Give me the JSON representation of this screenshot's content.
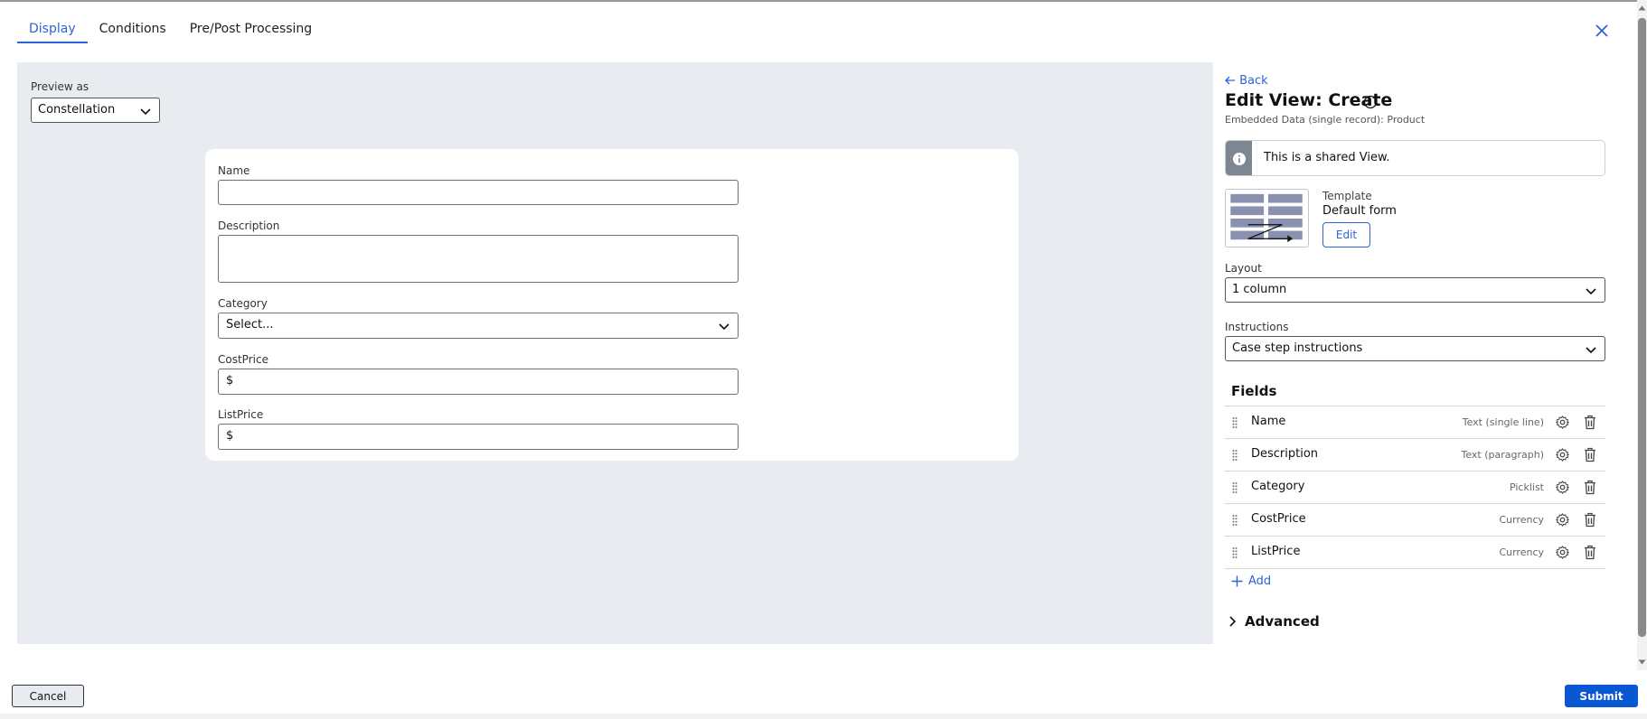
{
  "tabs": [
    {
      "label": "Display",
      "active": true
    },
    {
      "label": "Conditions",
      "active": false
    },
    {
      "label": "Pre/Post Processing",
      "active": false
    }
  ],
  "preview": {
    "label": "Preview as",
    "selected": "Constellation"
  },
  "form": {
    "name_label": "Name",
    "description_label": "Description",
    "category_label": "Category",
    "category_value": "Select...",
    "costprice_label": "CostPrice",
    "costprice_prefix": "$",
    "listprice_label": "ListPrice",
    "listprice_prefix": "$"
  },
  "panel": {
    "back": "Back",
    "title": "Edit View: Create",
    "subtitle": "Embedded Data (single record): Product",
    "shared_message": "This is a shared View.",
    "template_label": "Template",
    "template_value": "Default form",
    "template_edit": "Edit",
    "layout_label": "Layout",
    "layout_value": "1 column",
    "instructions_label": "Instructions",
    "instructions_value": "Case step instructions",
    "fields_heading": "Fields",
    "fields": [
      {
        "name": "Name",
        "type": "Text (single line)"
      },
      {
        "name": "Description",
        "type": "Text (paragraph)"
      },
      {
        "name": "Category",
        "type": "Picklist"
      },
      {
        "name": "CostPrice",
        "type": "Currency"
      },
      {
        "name": "ListPrice",
        "type": "Currency"
      }
    ],
    "add_label": "Add",
    "advanced_label": "Advanced"
  },
  "footer": {
    "cancel": "Cancel",
    "submit": "Submit"
  },
  "colors": {
    "accent": "#2b63d9",
    "submit_bg": "#0a57d4",
    "canvas_bg": "#e8ecf0",
    "template_blocks": "#8a90b0"
  },
  "icons": [
    "close-icon",
    "chevron-down-icon",
    "arrow-left-icon",
    "info-icon",
    "drag-handle-icon",
    "gear-icon",
    "trash-icon",
    "plus-icon",
    "chevron-right-icon"
  ]
}
